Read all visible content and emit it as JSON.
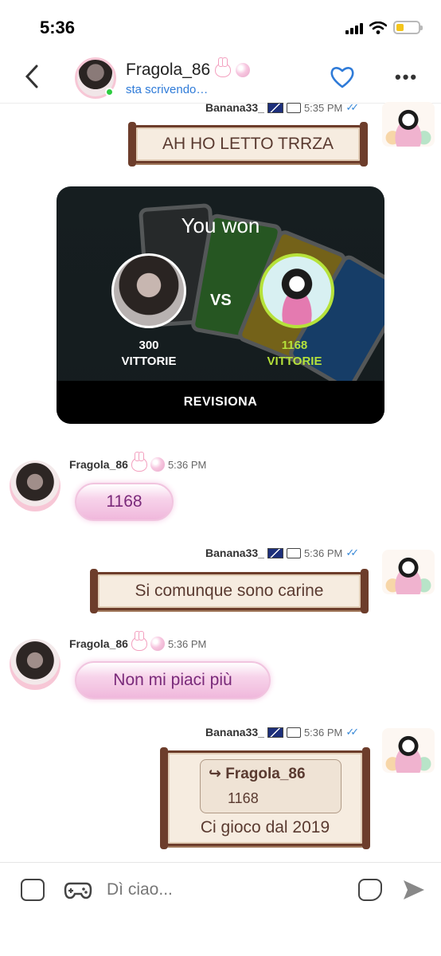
{
  "status": {
    "time": "5:36"
  },
  "header": {
    "name": "Fragola_86",
    "subtitle": "sta scrivendo…"
  },
  "messages": [
    {
      "sender": "Banana33_",
      "time": "5:35 PM",
      "text": "AH HO LETTO TRRZA"
    },
    {
      "type": "game_result",
      "title": "You won",
      "vs": "VS",
      "left_score": "300",
      "left_label": "VITTORIE",
      "right_score": "1168",
      "right_label": "VITTORIE",
      "action": "REVISIONA"
    },
    {
      "sender": "Fragola_86",
      "time": "5:36 PM",
      "text": "1168"
    },
    {
      "sender": "Banana33_",
      "time": "5:36 PM",
      "text": "Si comunque sono carine"
    },
    {
      "sender": "Fragola_86",
      "time": "5:36 PM",
      "text": "Non mi piaci più"
    },
    {
      "sender": "Banana33_",
      "time": "5:36 PM",
      "quote": {
        "name": "Fragola_86",
        "text": "1168"
      },
      "text": "Ci gioco dal 2019"
    }
  ],
  "input": {
    "placeholder": "Dì ciao..."
  },
  "colors": {
    "link_blue": "#2f7bd8",
    "win_green": "#b6e23a",
    "scroll_brown": "#6d3d2b",
    "pink_text": "#7a2a7a"
  },
  "icons": [
    "back-icon",
    "heart-icon",
    "more-icon",
    "sticker-icon",
    "game-controller-icon",
    "note-icon",
    "send-icon"
  ]
}
